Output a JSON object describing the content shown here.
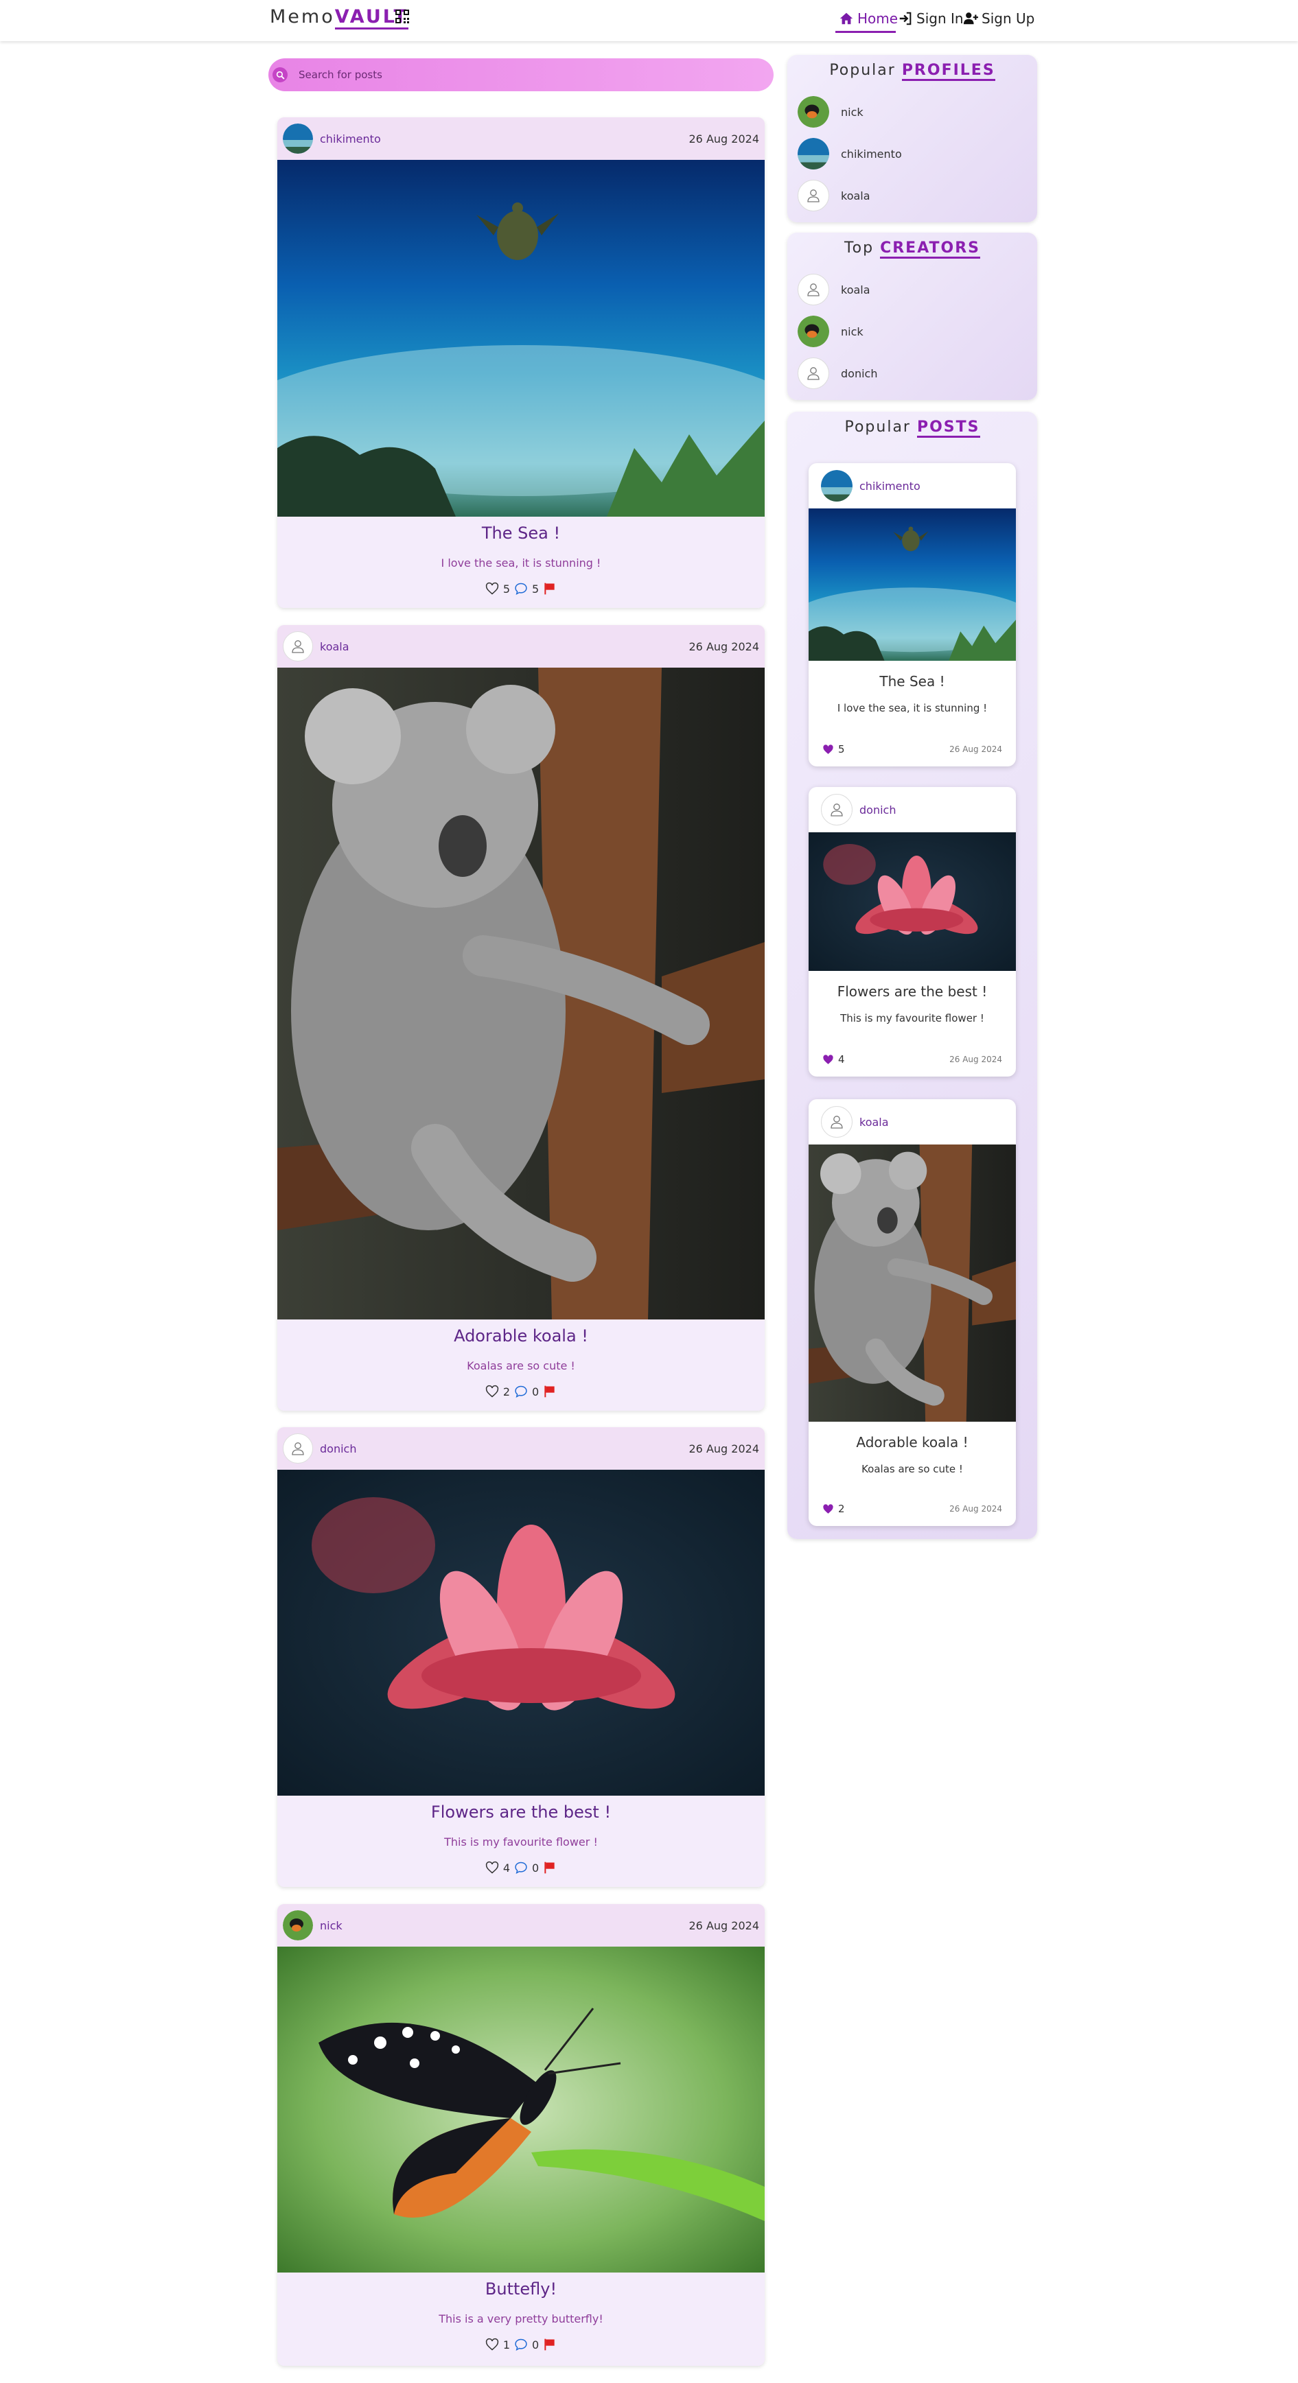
{
  "app": {
    "logo_prefix": "Memo",
    "logo_accent": "VAULT",
    "brand_color": "#8b1fb0"
  },
  "nav": {
    "home": "Home",
    "sign_in": "Sign In",
    "sign_up": "Sign Up"
  },
  "search": {
    "placeholder": "Search for posts"
  },
  "posts": [
    {
      "user": "chikimento",
      "date": "26 Aug 2024",
      "title": "The Sea !",
      "desc": "I love the sea, it is stunning !",
      "likes": "5",
      "comments": "5",
      "image": "sea"
    },
    {
      "user": "koala",
      "date": "26 Aug 2024",
      "title": "Adorable koala !",
      "desc": "Koalas are so cute !",
      "likes": "2",
      "comments": "0",
      "image": "koala"
    },
    {
      "user": "donich",
      "date": "26 Aug 2024",
      "title": "Flowers are the best !",
      "desc": "This is my favourite flower !",
      "likes": "4",
      "comments": "0",
      "image": "flower"
    },
    {
      "user": "nick",
      "date": "26 Aug 2024",
      "title": "Buttefly!",
      "desc": "This is a very pretty butterfly!",
      "likes": "1",
      "comments": "0",
      "image": "butterfly"
    }
  ],
  "popular_profiles": {
    "title_prefix": "Popular",
    "title_accent": "PROFILES",
    "items": [
      "nick",
      "chikimento",
      "koala"
    ]
  },
  "top_creators": {
    "title_prefix": "Top",
    "title_accent": "CREATORS",
    "items": [
      "koala",
      "nick",
      "donich"
    ]
  },
  "popular_posts": {
    "title_prefix": "Popular",
    "title_accent": "POSTS",
    "items": [
      {
        "user": "chikimento",
        "title": "The Sea !",
        "desc": "I love the sea, it is stunning !",
        "likes": "5",
        "date": "26 Aug 2024"
      },
      {
        "user": "donich",
        "title": "Flowers are the best !",
        "desc": "This is my favourite flower !",
        "likes": "4",
        "date": "26 Aug 2024"
      },
      {
        "user": "koala",
        "title": "Adorable koala !",
        "desc": "Koalas are so cute !",
        "likes": "2",
        "date": "26 Aug 2024"
      }
    ]
  }
}
